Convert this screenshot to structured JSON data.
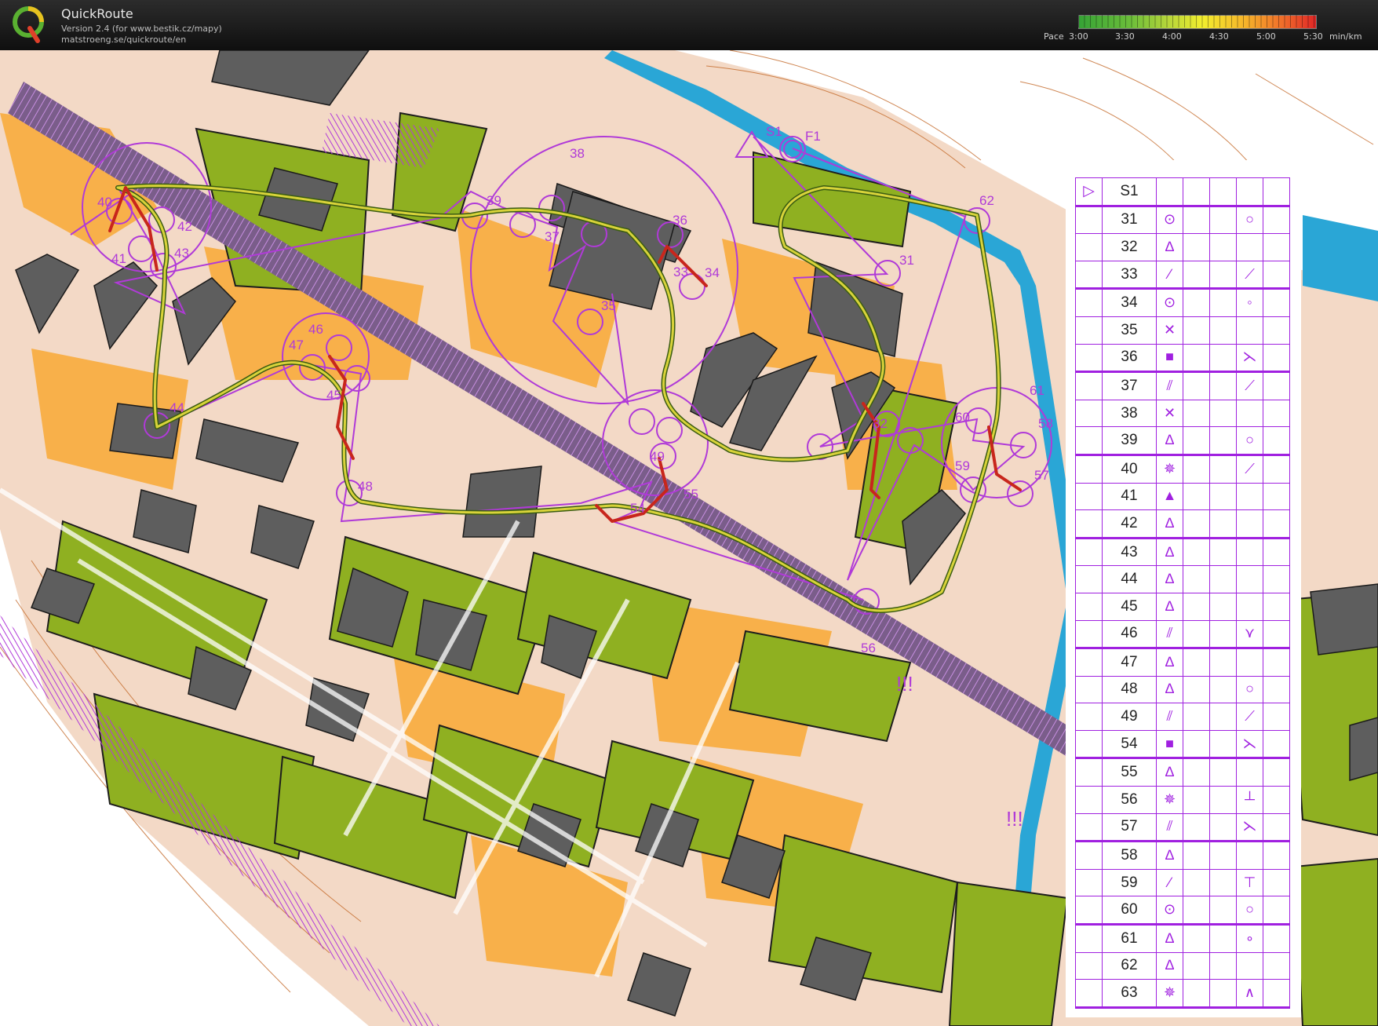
{
  "app": {
    "title": "QuickRoute",
    "version_line": "Version 2.4  (for www.bestik.cz/mapy)",
    "url_line": "matstroeng.se/quickroute/en",
    "logo_letter": "Q"
  },
  "pace_legend": {
    "label": "Pace",
    "ticks": [
      "3:00",
      "3:30",
      "4:00",
      "4:30",
      "5:00",
      "5:30"
    ],
    "unit": "min/km"
  },
  "map": {
    "annotations": [
      "!!!",
      "!!!"
    ],
    "controls": [
      {
        "code": "S1"
      },
      {
        "code": "F1"
      },
      {
        "code": "31"
      },
      {
        "code": "32"
      },
      {
        "code": "33"
      },
      {
        "code": "34"
      },
      {
        "code": "35"
      },
      {
        "code": "36"
      },
      {
        "code": "37"
      },
      {
        "code": "38"
      },
      {
        "code": "39"
      },
      {
        "code": "40"
      },
      {
        "code": "41"
      },
      {
        "code": "42"
      },
      {
        "code": "43"
      },
      {
        "code": "44"
      },
      {
        "code": "45"
      },
      {
        "code": "46"
      },
      {
        "code": "47"
      },
      {
        "code": "48"
      },
      {
        "code": "49"
      },
      {
        "code": "54"
      },
      {
        "code": "55"
      },
      {
        "code": "56"
      },
      {
        "code": "57"
      },
      {
        "code": "58"
      },
      {
        "code": "59"
      },
      {
        "code": "60"
      },
      {
        "code": "61"
      },
      {
        "code": "62"
      },
      {
        "code": "63"
      }
    ]
  },
  "description_sheet": {
    "rows": [
      {
        "code": "S1",
        "feature": "start-triangle",
        "detail": ""
      },
      {
        "code": "31",
        "feature": "ring-dot",
        "detail": "loop-tail"
      },
      {
        "code": "32",
        "feature": "tree",
        "detail": ""
      },
      {
        "code": "33",
        "feature": "dotted-diagonal",
        "detail": "side-tick"
      },
      {
        "code": "34",
        "feature": "ring-dot",
        "detail": "dot-ring"
      },
      {
        "code": "35",
        "feature": "cross",
        "detail": ""
      },
      {
        "code": "36",
        "feature": "filled-square",
        "detail": "corner-dot"
      },
      {
        "code": "37",
        "feature": "hatched-slope",
        "detail": "side-tick"
      },
      {
        "code": "38",
        "feature": "cross",
        "detail": ""
      },
      {
        "code": "39",
        "feature": "tree",
        "detail": "loop-low"
      },
      {
        "code": "40",
        "feature": "hash-star",
        "detail": "side-tick"
      },
      {
        "code": "41",
        "feature": "filled-triangle",
        "detail": ""
      },
      {
        "code": "42",
        "feature": "tree",
        "detail": ""
      },
      {
        "code": "43",
        "feature": "tree",
        "detail": ""
      },
      {
        "code": "44",
        "feature": "tree",
        "detail": ""
      },
      {
        "code": "45",
        "feature": "tree",
        "detail": ""
      },
      {
        "code": "46",
        "feature": "hatched-slope",
        "detail": "fork-dot"
      },
      {
        "code": "47",
        "feature": "tree",
        "detail": ""
      },
      {
        "code": "48",
        "feature": "tree",
        "detail": "loop-tail"
      },
      {
        "code": "49",
        "feature": "hatched-slope",
        "detail": "side-tick"
      },
      {
        "code": "54",
        "feature": "filled-square",
        "detail": "corner-dot"
      },
      {
        "code": "55",
        "feature": "tree",
        "detail": ""
      },
      {
        "code": "56",
        "feature": "hash-star",
        "detail": "foot-tick"
      },
      {
        "code": "57",
        "feature": "hatched-slope",
        "detail": "corner-dot"
      },
      {
        "code": "58",
        "feature": "tree",
        "detail": ""
      },
      {
        "code": "59",
        "feature": "dotted-diagonal",
        "detail": "t-bar"
      },
      {
        "code": "60",
        "feature": "ring-dot",
        "detail": "loop-low"
      },
      {
        "code": "61",
        "feature": "tree",
        "detail": "ring-top-dot"
      },
      {
        "code": "62",
        "feature": "tree",
        "detail": ""
      },
      {
        "code": "63",
        "feature": "hash-star",
        "detail": "roof"
      }
    ]
  },
  "colors": {
    "course": "#b03ad8",
    "green_dark": "#8fb021",
    "building": "#5e5e5e",
    "water": "#2aa6d6",
    "open": "#f8b04a",
    "paved": "#f3d8c2"
  }
}
